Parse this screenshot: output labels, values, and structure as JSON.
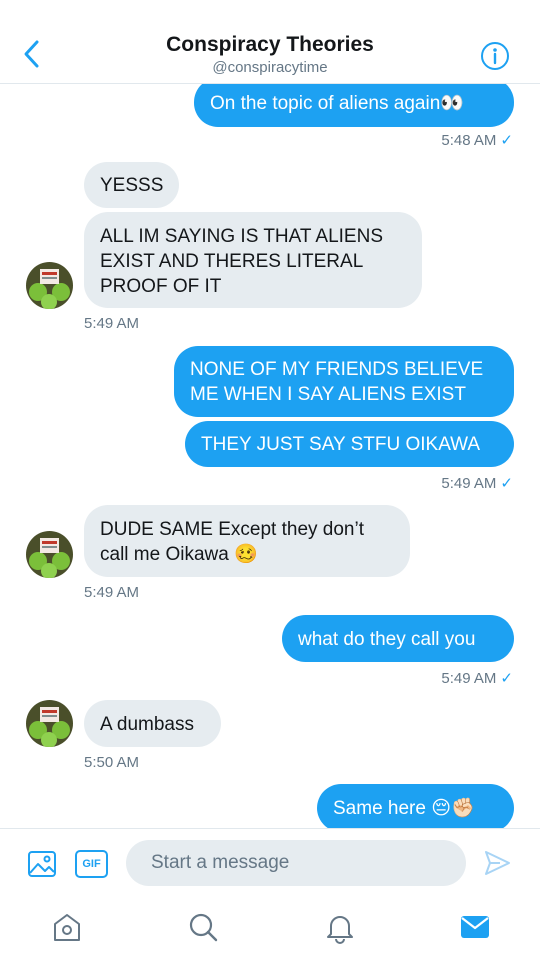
{
  "header": {
    "title": "Conspiracy Theories",
    "handle": "@conspiracytime",
    "back_icon": "chevron-left-icon",
    "info_icon": "info-icon"
  },
  "messages": [
    {
      "id": "m1",
      "dir": "out",
      "text": "On the topic of aliens again👀"
    },
    {
      "id": "t1",
      "time": "5:48 AM",
      "read": "✓"
    },
    {
      "id": "m2",
      "dir": "in",
      "text": "YESSS"
    },
    {
      "id": "m3",
      "dir": "in",
      "text": "ALL IM SAYING IS THAT ALIENS EXIST AND THERES LITERAL PROOF OF IT"
    },
    {
      "id": "t2",
      "time": "5:49 AM"
    },
    {
      "id": "m4",
      "dir": "out",
      "text": "NONE OF MY FRIENDS BELIEVE ME WHEN I SAY ALIENS EXIST"
    },
    {
      "id": "m5",
      "dir": "out",
      "text": "THEY JUST SAY STFU OIKAWA"
    },
    {
      "id": "t3",
      "time": "5:49 AM",
      "read": "✓"
    },
    {
      "id": "m6",
      "dir": "in",
      "text": "DUDE SAME Except they don’t call me Oikawa 🥴"
    },
    {
      "id": "t4",
      "time": "5:49 AM"
    },
    {
      "id": "m7",
      "dir": "out",
      "text": "what do they call you"
    },
    {
      "id": "t5",
      "time": "5:49 AM",
      "read": "✓"
    },
    {
      "id": "m8",
      "dir": "in",
      "text": "A dumbass"
    },
    {
      "id": "t6",
      "time": "5:50 AM"
    },
    {
      "id": "m9",
      "dir": "out",
      "text": "Same here 😔✊🏻"
    }
  ],
  "composer": {
    "placeholder": "Start a message",
    "gif_label": "GIF",
    "image_icon": "image-icon",
    "send_icon": "send-icon"
  },
  "tabbar": [
    "home-icon",
    "search-icon",
    "notifications-bell-icon",
    "messages-envelope-icon"
  ],
  "colors": {
    "accent": "#1da1f2",
    "incoming_bubble": "#e6ecf0",
    "muted_text": "#657786"
  }
}
